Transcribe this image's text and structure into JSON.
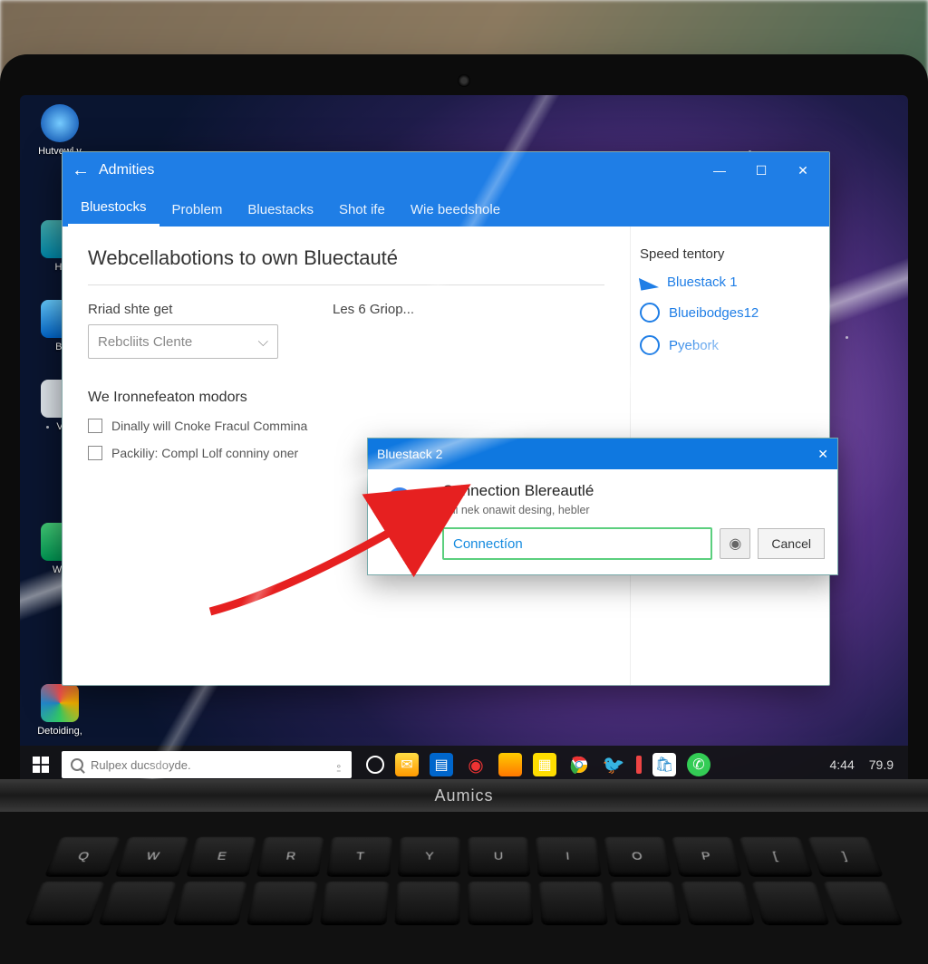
{
  "desktop_icons": [
    {
      "label": "Hutvewl v"
    },
    {
      "label": "Ht"
    },
    {
      "label": "Bi"
    },
    {
      "label": "V"
    },
    {
      "label": "Wo"
    },
    {
      "label": "Detoiding,"
    }
  ],
  "window": {
    "title": "Admities",
    "tabs": [
      "Bluestocks",
      "Problem",
      "Bluestacks",
      "Shot ife",
      "Wie beedshole"
    ],
    "active_tab": 0,
    "heading": "Webcellabotions to own Bluectauté",
    "field1_label": "Rriad shte get",
    "field1_value": "Rebcliits Clente",
    "field2_label": "Les 6 Griop...",
    "section2": "We Ironnefeaton modors",
    "check1": "Dinally will Cnoke Fracul Commina",
    "check2": "Packiliy: Compl Lolf conniny oner",
    "side_heading": "Speed tentory",
    "side_links": [
      "Bluestack 1",
      "Blueibodges12",
      "Pyebork"
    ]
  },
  "dialog": {
    "title": "Bluestack 2",
    "heading": "Connection Blereautlé",
    "sub": "Thi nek onawit desing, hebler",
    "input_value": "Connectíon",
    "cancel": "Cancel"
  },
  "taskbar": {
    "search_placeholder": "Rulpex ducsdoyde.",
    "clock": "4:44",
    "sys": "79.9"
  },
  "laptop_brand": "Aumics",
  "key_row": [
    "Q",
    "W",
    "E",
    "R",
    "T",
    "Y",
    "U",
    "I",
    "O",
    "P",
    "[",
    "]"
  ]
}
